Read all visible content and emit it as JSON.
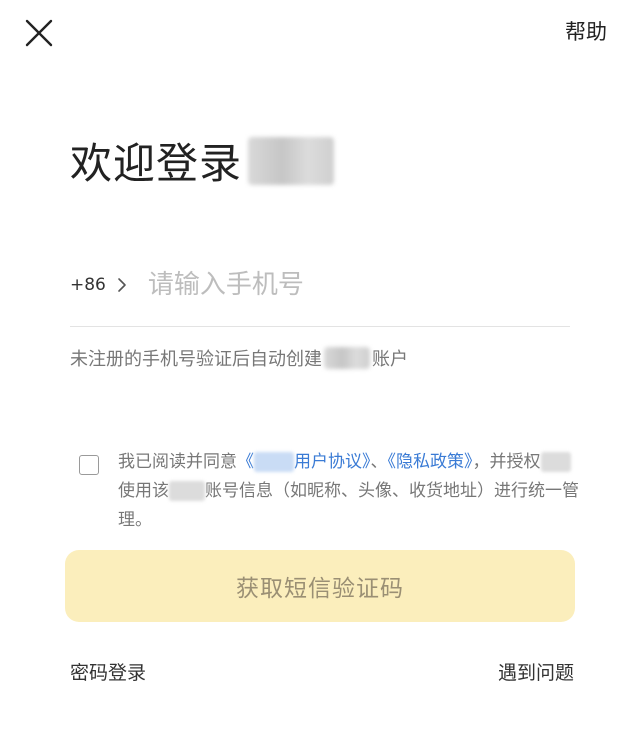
{
  "header": {
    "close_icon": "close-icon",
    "help_label": "帮助"
  },
  "welcome": {
    "title": "欢迎登录"
  },
  "phone": {
    "country_code": "+86",
    "chevron_icon": "chevron-right-icon",
    "placeholder": "请输入手机号",
    "value": ""
  },
  "hint": {
    "before": "未注册的手机号验证后自动创建",
    "after": "账户"
  },
  "agreement": {
    "checked": false,
    "part1": "我已阅读并同意",
    "user_agreement_open": "《",
    "user_agreement_label": "用户协议》",
    "separator": "、",
    "privacy_label": "《隐私政策》",
    "comma": "，",
    "part2": "并授权",
    "part3": "使用该",
    "part4": "账号信息（如昵称、头像、收货地址）进行统一管理。"
  },
  "actions": {
    "sms_button_label": "获取短信验证码",
    "password_login_label": "密码登录",
    "problem_label": "遇到问题"
  },
  "colors": {
    "accent_link": "#3a7bd5",
    "button_bg": "#fbeebc",
    "button_text": "#9a8f74"
  }
}
